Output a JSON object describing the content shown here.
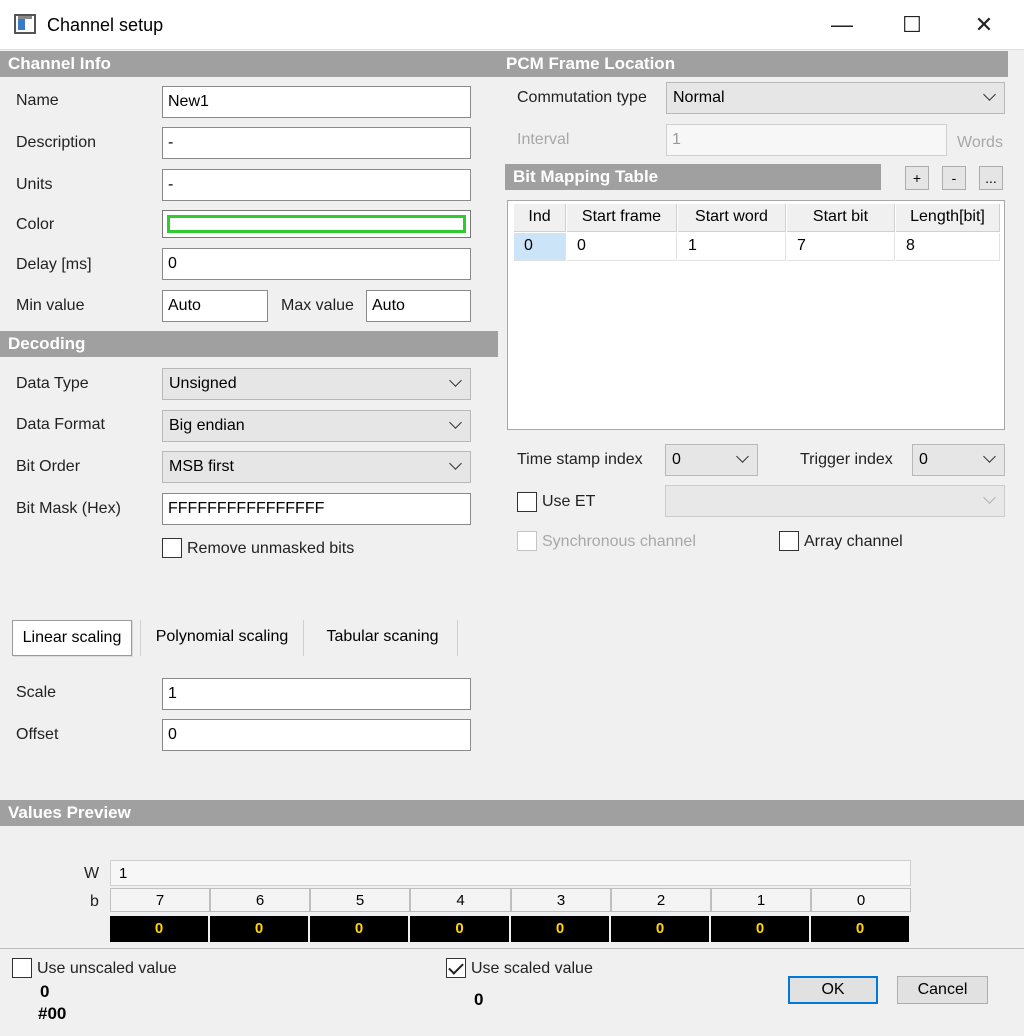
{
  "window": {
    "title": "Channel setup",
    "minimize": "—",
    "maximize": "☐",
    "close": "✕"
  },
  "channel_info": {
    "header": "Channel Info",
    "name_label": "Name",
    "name_value": "New1",
    "description_label": "Description",
    "description_value": "-",
    "units_label": "Units",
    "units_value": "-",
    "color_label": "Color",
    "color_value": "#2ecc2e",
    "delay_label": "Delay [ms]",
    "delay_value": "0",
    "min_label": "Min value",
    "min_value": "Auto",
    "max_label": "Max value",
    "max_value": "Auto"
  },
  "decoding": {
    "header": "Decoding",
    "data_type_label": "Data Type",
    "data_type_value": "Unsigned",
    "data_format_label": "Data Format",
    "data_format_value": "Big endian",
    "bit_order_label": "Bit Order",
    "bit_order_value": "MSB first",
    "bit_mask_label": "Bit Mask (Hex)",
    "bit_mask_value": "FFFFFFFFFFFFFFFF",
    "remove_unmasked_label": "Remove unmasked bits",
    "remove_unmasked_checked": false
  },
  "scaling": {
    "tabs": [
      "Linear scaling",
      "Polynomial scaling",
      "Tabular scaning"
    ],
    "active_tab": 0,
    "scale_label": "Scale",
    "scale_value": "1",
    "offset_label": "Offset",
    "offset_value": "0"
  },
  "pcm": {
    "header": "PCM Frame Location",
    "commutation_label": "Commutation type",
    "commutation_value": "Normal",
    "interval_label": "Interval",
    "interval_value": "1",
    "interval_unit": "Words",
    "bit_mapping_header": "Bit Mapping Table",
    "add_btn": "+",
    "remove_btn": "-",
    "more_btn": "...",
    "columns": [
      "Ind",
      "Start frame",
      "Start word",
      "Start bit",
      "Length[bit]"
    ],
    "rows": [
      [
        "0",
        "0",
        "1",
        "7",
        "8"
      ]
    ],
    "timestamp_label": "Time stamp index",
    "timestamp_value": "0",
    "trigger_label": "Trigger index",
    "trigger_value": "0",
    "use_et_label": "Use ET",
    "use_et_checked": false,
    "use_et_value": "",
    "synchronous_label": "Synchronous channel",
    "array_label": "Array channel"
  },
  "preview": {
    "header": "Values Preview",
    "w_label": "W",
    "w_value": "1",
    "b_label": "b",
    "bits": [
      "7",
      "6",
      "5",
      "4",
      "3",
      "2",
      "1",
      "0"
    ],
    "bit_values": [
      "0",
      "0",
      "0",
      "0",
      "0",
      "0",
      "0",
      "0"
    ]
  },
  "footer": {
    "use_unscaled_label": "Use unscaled value",
    "use_unscaled_checked": false,
    "unscaled_value": "0",
    "unscaled_hex": "#00",
    "use_scaled_label": "Use scaled value",
    "use_scaled_checked": true,
    "scaled_value": "0",
    "ok": "OK",
    "cancel": "Cancel"
  }
}
